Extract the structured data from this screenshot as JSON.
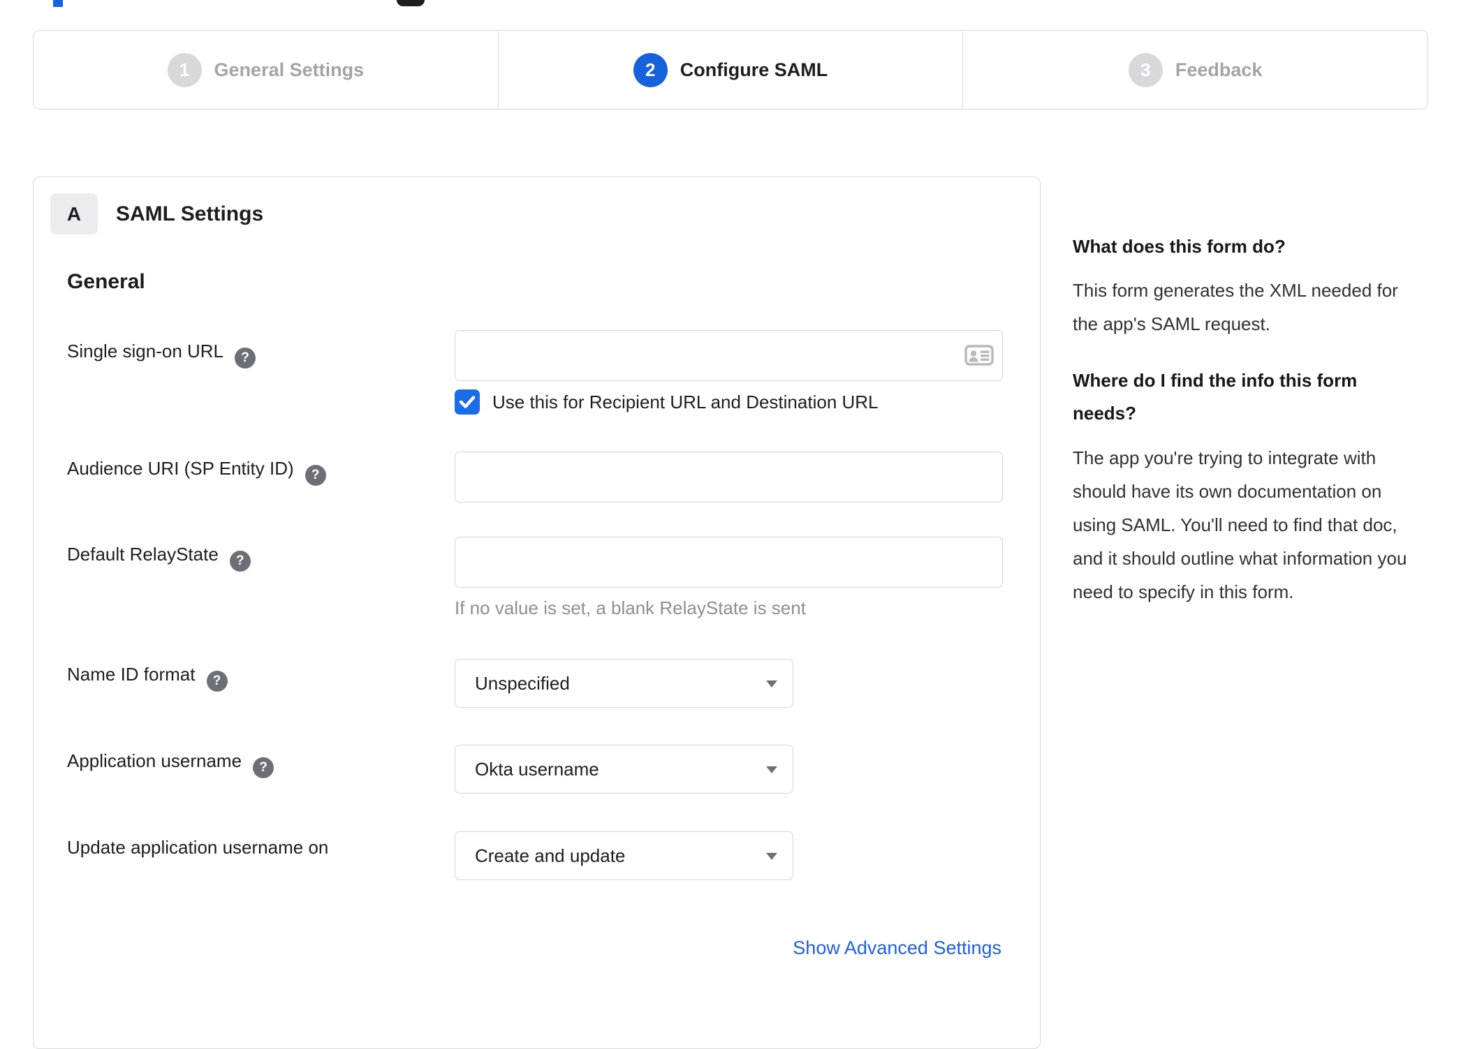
{
  "colors": {
    "accent": "#1662dd",
    "checkbox_blue": "#1b6ce8",
    "link_blue": "#1f5fe0",
    "border": "#d8d8d8",
    "input_border": "#d4d4d8",
    "inactive_circle": "#d8d8da",
    "inactive_label": "#a3a3a9",
    "icon_gray": "#6e6e76",
    "text_gray": "#8e8e93"
  },
  "icons": {
    "help_glyph": "?"
  },
  "stepper": {
    "steps": [
      {
        "number": "1",
        "label": "General Settings",
        "state": "inactive"
      },
      {
        "number": "2",
        "label": "Configure SAML",
        "state": "active"
      },
      {
        "number": "3",
        "label": "Feedback",
        "state": "inactive"
      }
    ]
  },
  "panel": {
    "badge": "A",
    "title": "SAML Settings",
    "section_heading": "General",
    "fields": [
      {
        "label": "Single sign-on URL",
        "help": true,
        "type": "text",
        "value": "",
        "trailing_icon": "contact-card-icon",
        "checkbox_checked": true,
        "checkbox_label": "Use this for Recipient URL and Destination URL"
      },
      {
        "label": "Audience URI (SP Entity ID)",
        "help": true,
        "type": "text",
        "value": ""
      },
      {
        "label": "Default RelayState",
        "help": true,
        "type": "text",
        "value": "",
        "hint": "If no value is set, a blank RelayState is sent"
      },
      {
        "label": "Name ID format",
        "help": true,
        "type": "select",
        "value": "Unspecified"
      },
      {
        "label": "Application username",
        "help": true,
        "type": "select",
        "value": "Okta username"
      },
      {
        "label": "Update application username on",
        "help": false,
        "type": "select",
        "value": "Create and update"
      }
    ],
    "advanced_link": "Show Advanced Settings"
  },
  "sidebar": {
    "sections": [
      {
        "heading": "What does this form do?",
        "body": "This form generates the XML needed for the app's SAML request."
      },
      {
        "heading": "Where do I find the info this form needs?",
        "body": "The app you're trying to integrate with should have its own documentation on using SAML. You'll need to find that doc, and it should outline what information you need to specify in this form."
      }
    ]
  }
}
